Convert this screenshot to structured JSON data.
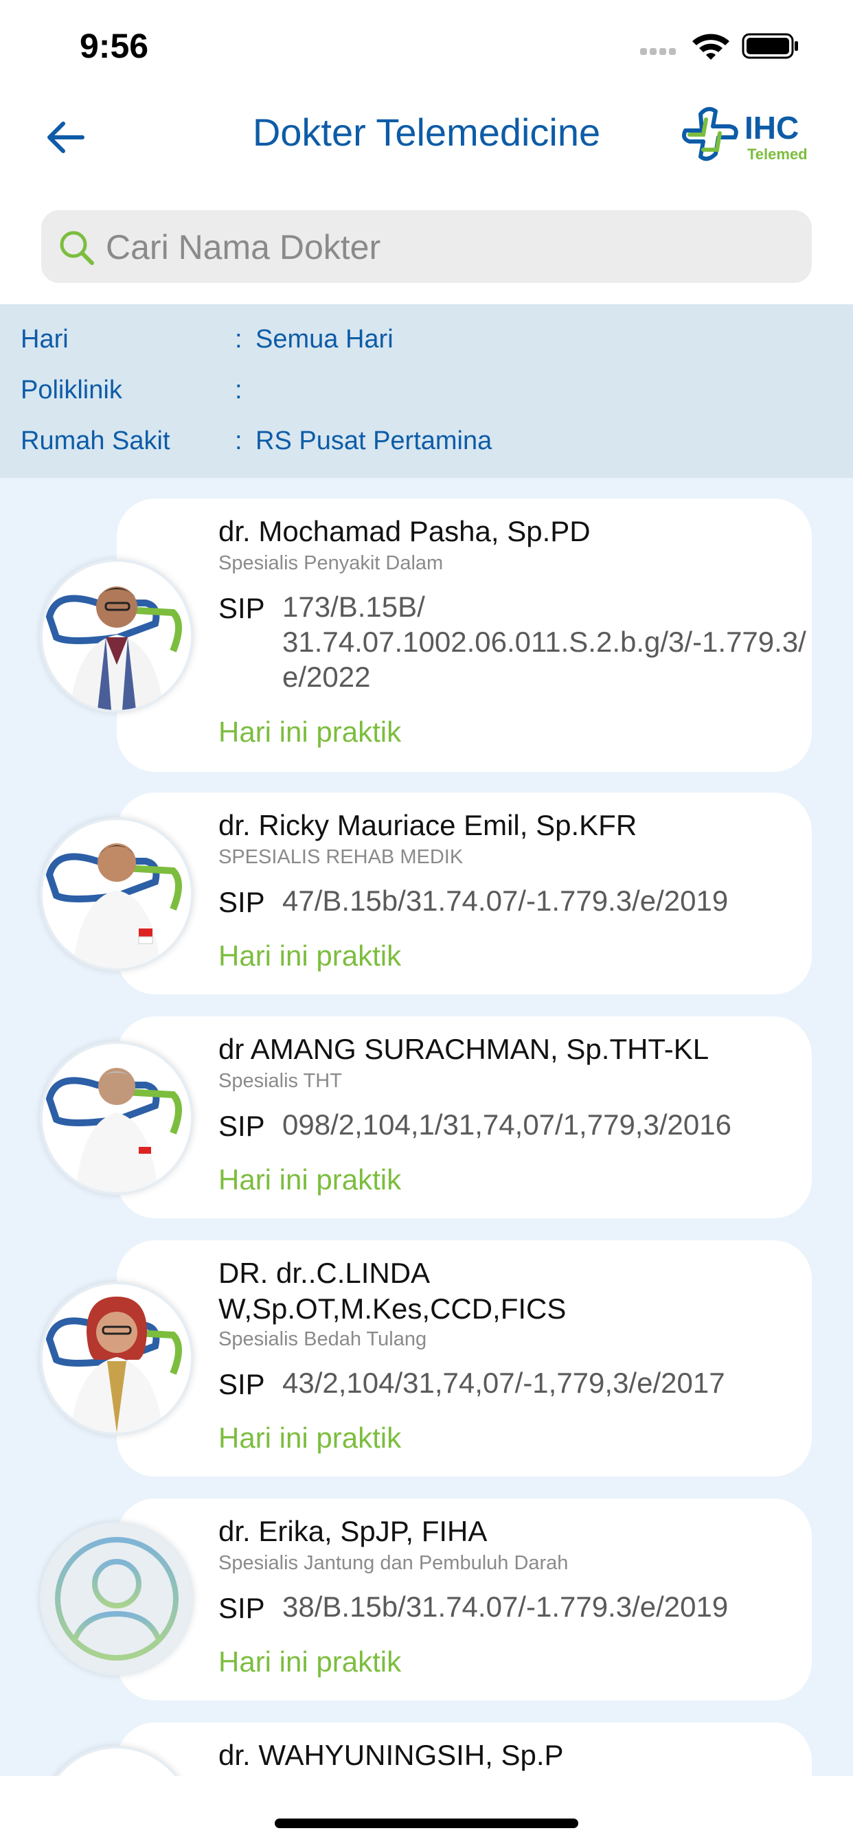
{
  "status": {
    "time": "9:56"
  },
  "header": {
    "title": "Dokter Telemedicine",
    "logo_text": "IHC",
    "logo_sub": "Telemed"
  },
  "search": {
    "placeholder": "Cari Nama Dokter",
    "value": ""
  },
  "filters": [
    {
      "label": "Hari",
      "value": "Semua Hari"
    },
    {
      "label": "Poliklinik",
      "value": ""
    },
    {
      "label": "Rumah Sakit",
      "value": "RS Pusat Pertamina"
    }
  ],
  "doctors": [
    {
      "name": "dr. Mochamad Pasha, Sp.PD",
      "specialty": "Spesialis Penyakit Dalam",
      "sip_label": "SIP",
      "sip_lines": [
        "173/B.15B/",
        "31.74.07.1002.06.011.S.2.b.g/3/-1.779.3/",
        "e/2022"
      ],
      "status": "Hari ini praktik"
    },
    {
      "name": "dr. Ricky Mauriace Emil, Sp.KFR",
      "specialty": "SPESIALIS REHAB MEDIK",
      "sip_label": "SIP",
      "sip_lines": [
        "47/B.15b/31.74.07/-1.779.3/e/2019"
      ],
      "status": "Hari ini praktik"
    },
    {
      "name": "dr AMANG SURACHMAN, Sp.THT-KL",
      "specialty": "Spesialis THT",
      "sip_label": "SIP",
      "sip_lines": [
        "098/2,104,1/31,74,07/1,779,3/2016"
      ],
      "status": "Hari ini praktik"
    },
    {
      "name_lines": [
        "DR. dr..C.LINDA",
        "W,Sp.OT,M.Kes,CCD,FICS"
      ],
      "specialty": "Spesialis Bedah Tulang",
      "sip_label": "SIP",
      "sip_lines": [
        "43/2,104/31,74,07/-1,779,3/e/2017"
      ],
      "status": "Hari ini praktik"
    },
    {
      "name": "dr. Erika, SpJP, FIHA",
      "specialty": "Spesialis Jantung dan Pembuluh Darah",
      "sip_label": "SIP",
      "sip_lines": [
        "38/B.15b/31.74.07/-1.779.3/e/2019"
      ],
      "status": "Hari ini praktik"
    },
    {
      "name": "dr. WAHYUNINGSIH, Sp.P"
    }
  ]
}
